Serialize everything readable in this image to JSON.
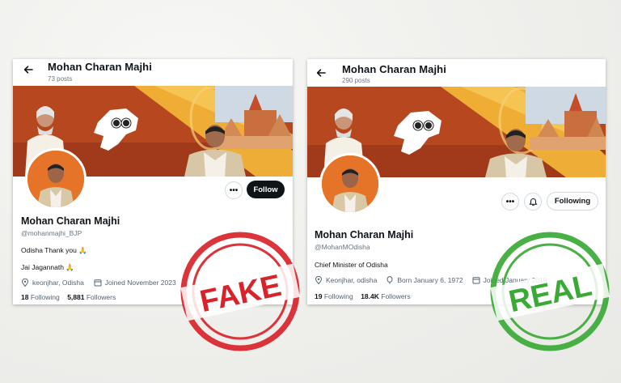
{
  "fake_profile": {
    "header_name": "Mohan Charan Majhi",
    "header_posts": "73 posts",
    "follow_label": "Follow",
    "more_label": "•••",
    "name": "Mohan Charan Majhi",
    "handle": "@mohanmajhi_BJP",
    "bio_line_1": "Odisha Thank you",
    "bio_line_2": "Jai Jagannath",
    "location": "keonjhar, Odisha",
    "joined": "Joined November 2023",
    "following_count": "18",
    "following_label": "Following",
    "followers_count": "5,881",
    "followers_label": "Followers"
  },
  "real_profile": {
    "header_name": "Mohan Charan Majhi",
    "header_posts": "290 posts",
    "following_button_label": "Following",
    "more_label": "•••",
    "name": "Mohan Charan Majhi",
    "handle": "@MohanMOdisha",
    "bio": "Chief Minister of Odisha",
    "location": "Keonjhar, odisha",
    "born": "Born January 6, 1972",
    "joined": "Joined January 2019",
    "following_count": "19",
    "following_label": "Following",
    "followers_count": "18.4K",
    "followers_label": "Followers"
  },
  "stamps": {
    "fake": "FAKE",
    "real": "REAL"
  },
  "colors": {
    "fake_stamp": "#d8232a",
    "real_stamp": "#3aa935",
    "banner_bg": "#b94a24",
    "banner_accent": "#f0b43a"
  },
  "icons": [
    "back-arrow-icon",
    "location-pin-icon",
    "calendar-icon",
    "balloon-icon",
    "notification-bell-icon",
    "folded-hands-emoji",
    "odisha-map-icon",
    "temple-image"
  ]
}
